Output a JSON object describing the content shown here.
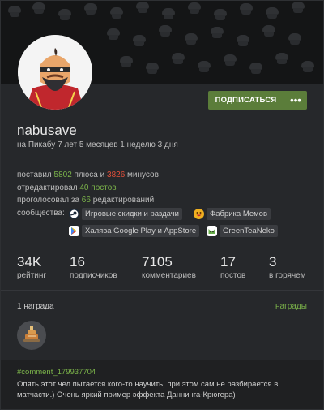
{
  "profile": {
    "username": "nabusave",
    "since": "на Пикабу 7 лет 5 месяцев 1 неделю 3 дня",
    "subscribe_label": "ПОДПИСАТЬСЯ",
    "more_label": "•••"
  },
  "activity": {
    "ratings_prefix": "поставил ",
    "plus_count": "5802",
    "plus_mid": " плюса и ",
    "minus_count": "3826",
    "minus_suffix": " минусов",
    "edited_prefix": "отредактировал ",
    "edited_posts": "40 постов",
    "voted_prefix": "проголосовал за ",
    "voted_count": "66",
    "voted_suffix": " редактирований"
  },
  "communities": {
    "label": "сообщества:",
    "items": [
      {
        "name": "Игровые скидки и раздачи",
        "icon": "steam-icon",
        "color": "#1b2838"
      },
      {
        "name": "Фабрика Мемов",
        "icon": "laughing-emoji-icon",
        "color": "#f0b020"
      },
      {
        "name": "Халява Google Play и AppStore",
        "icon": "google-play-icon",
        "color": "#ffffff"
      },
      {
        "name": "GreenTeaNeko",
        "icon": "cat-icon",
        "color": "#ffffff"
      }
    ]
  },
  "stats": [
    {
      "value": "34K",
      "label": "рейтинг"
    },
    {
      "value": "16",
      "label": "подписчиков"
    },
    {
      "value": "7105",
      "label": "комментариев"
    },
    {
      "value": "17",
      "label": "постов"
    },
    {
      "value": "3",
      "label": "в горячем"
    }
  ],
  "awards": {
    "count_label": "1 награда",
    "link_label": "награды",
    "badge_icon": "award-cake-icon"
  },
  "comment": {
    "tag": "#comment_179937704",
    "text": "Опять этот чел пытается кого-то научить, при этом сам не разбирается в матчасти.) Очень яркий пример эффекта Даннинга-Крюгера)"
  },
  "colors": {
    "accent": "#5b7d3a",
    "green_text": "#7bb34a",
    "red_text": "#e5503a"
  }
}
